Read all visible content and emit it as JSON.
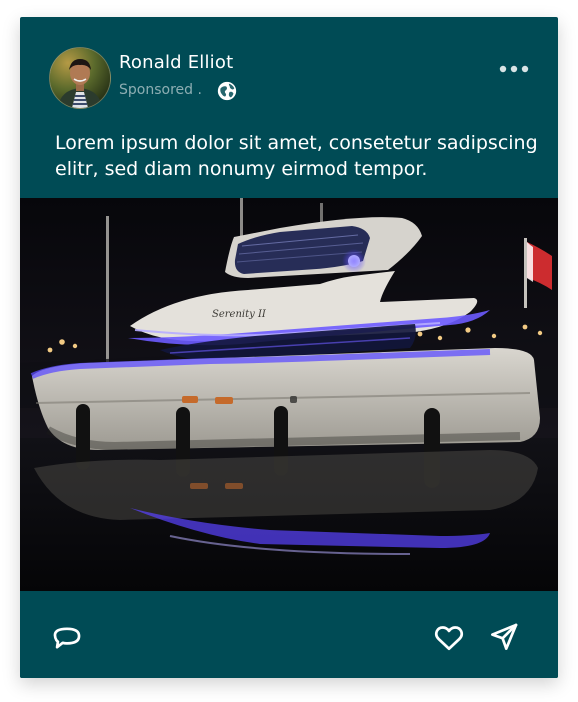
{
  "post": {
    "author_name": "Ronald Elliot",
    "sponsored_label": "Sponsored .",
    "caption": "Lorem ipsum dolor sit amet, consetetur sadipscing elitr, sed diam nonumy eirmod tempor.",
    "yacht_name": "Serenity II",
    "icons": {
      "privacy": "globe-icon",
      "menu": "more-options-icon",
      "comment": "comment-icon",
      "like": "heart-icon",
      "share": "send-icon"
    }
  },
  "colors": {
    "card_bg": "#004b55",
    "text": "#ffffff",
    "muted_text": "#8fb0b4"
  }
}
